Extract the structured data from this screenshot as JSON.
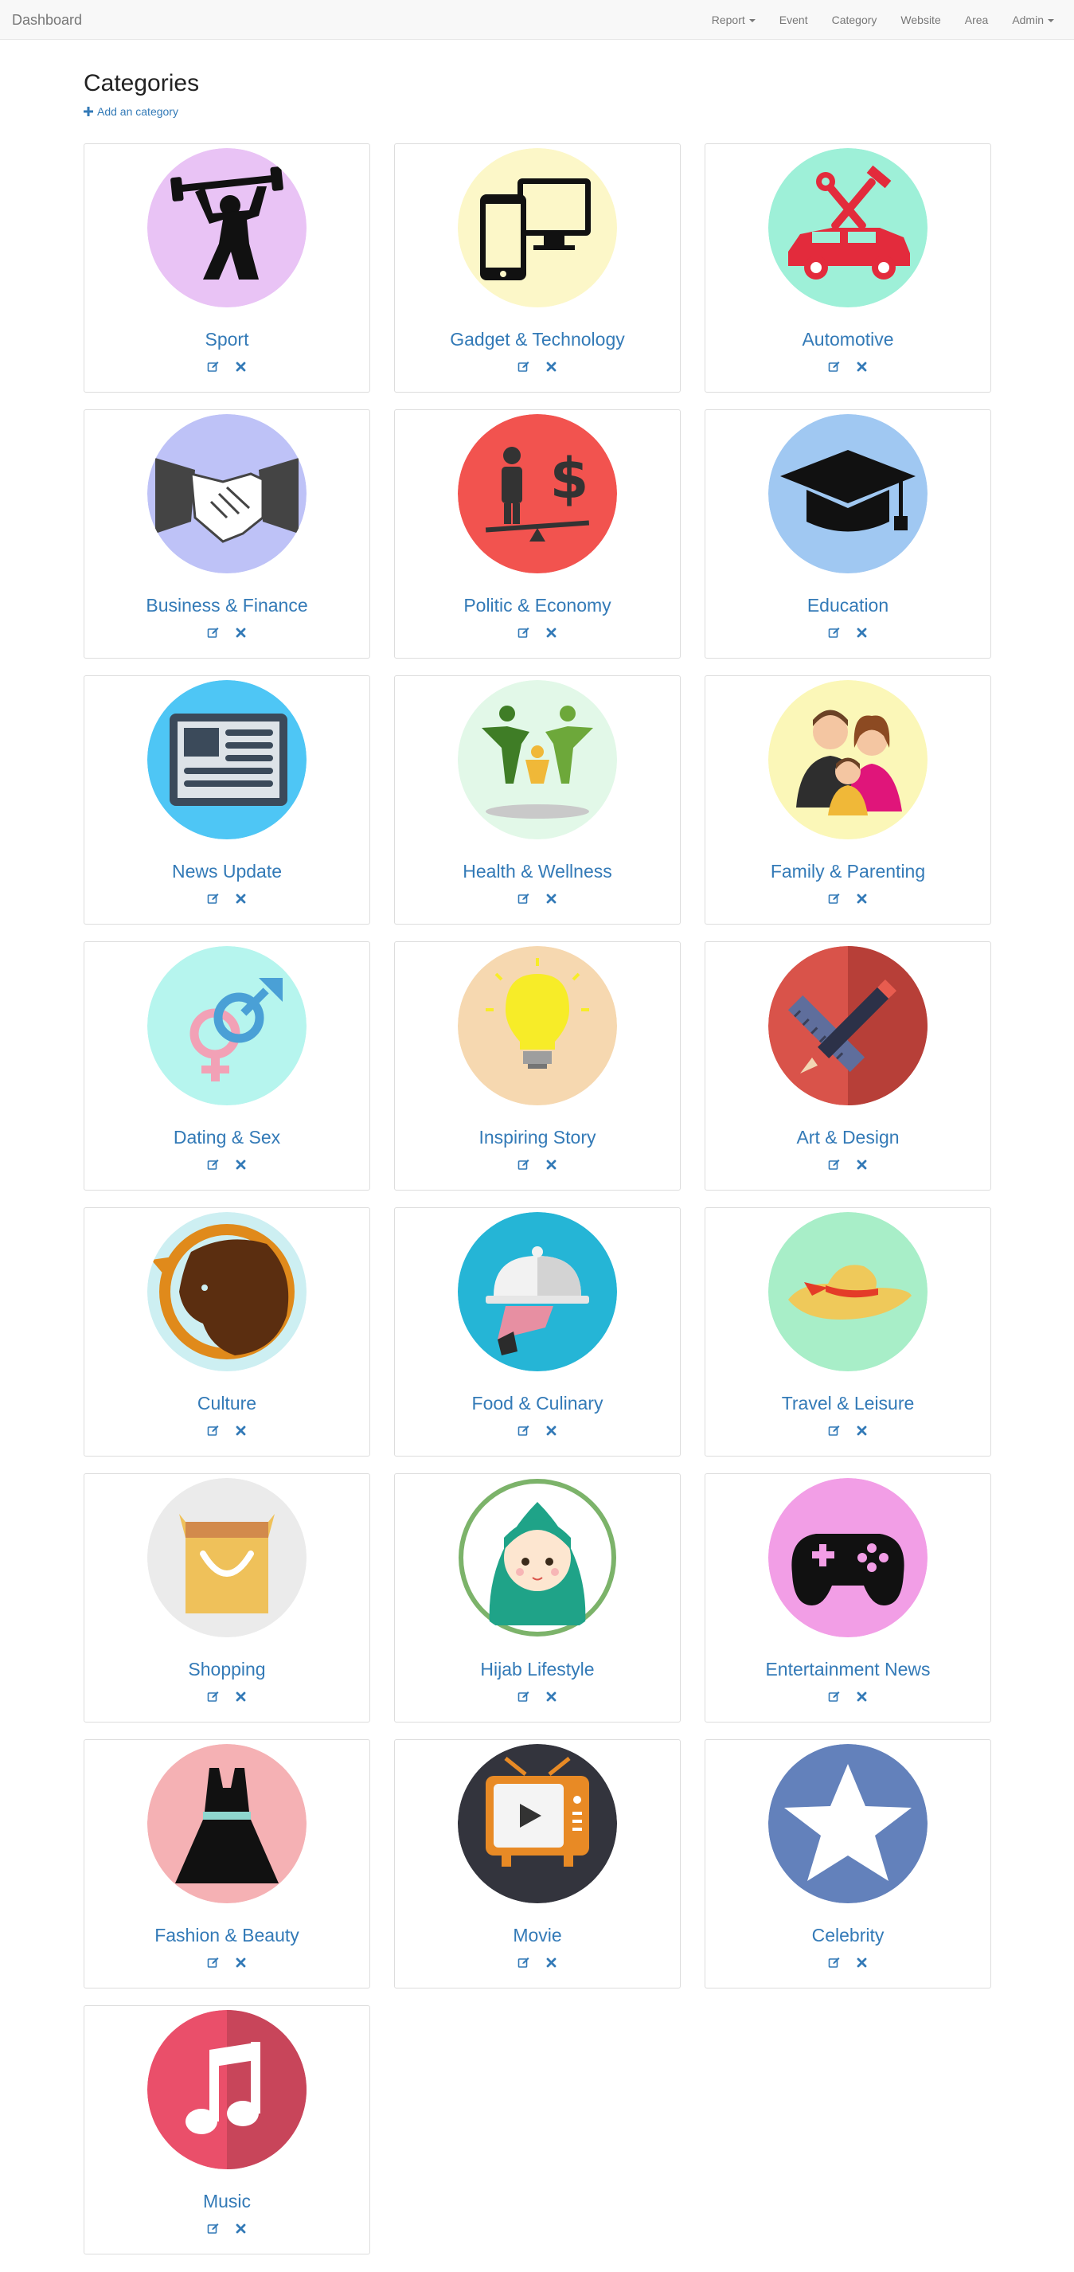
{
  "navbar": {
    "brand": "Dashboard",
    "items": [
      "Report",
      "Event",
      "Category",
      "Website",
      "Area",
      "Admin"
    ]
  },
  "page": {
    "title": "Categories",
    "add_label": "Add an category"
  },
  "colors": {
    "link": "#337ab7",
    "navbar_bg": "#f8f8f8"
  },
  "categories": [
    {
      "name": "Sport",
      "bg": "#e9c3f5",
      "icon": "weightlifter-icon"
    },
    {
      "name": "Gadget & Technology",
      "bg": "#fcf7c8",
      "icon": "devices-icon"
    },
    {
      "name": "Automotive",
      "bg": "#9ef0d8",
      "icon": "car-tools-icon"
    },
    {
      "name": "Business & Finance",
      "bg": "#bec2f7",
      "icon": "handshake-icon"
    },
    {
      "name": "Politic & Economy",
      "bg": "#f2534f",
      "icon": "balance-icon"
    },
    {
      "name": "Education",
      "bg": "#a0c8f2",
      "icon": "graduation-cap-icon"
    },
    {
      "name": "News Update",
      "bg": "#4ec6f5",
      "icon": "newspaper-icon"
    },
    {
      "name": "Health & Wellness",
      "bg": "#e2f8e8",
      "icon": "family-health-icon"
    },
    {
      "name": "Family & Parenting",
      "bg": "#fbf7b8",
      "icon": "family-icon"
    },
    {
      "name": "Dating & Sex",
      "bg": "#b6f5ee",
      "icon": "gender-symbols-icon"
    },
    {
      "name": "Inspiring Story",
      "bg": "#f6d8b0",
      "icon": "lightbulb-icon"
    },
    {
      "name": "Art & Design",
      "bg": "#d9534a",
      "icon": "pencil-ruler-icon"
    },
    {
      "name": "Culture",
      "bg": "#cdeff2",
      "icon": "culture-icon"
    },
    {
      "name": "Food & Culinary",
      "bg": "#25b5d6",
      "icon": "cloche-icon"
    },
    {
      "name": "Travel & Leisure",
      "bg": "#a8eec8",
      "icon": "sun-hat-icon"
    },
    {
      "name": "Shopping",
      "bg": "#ebebeb",
      "icon": "shopping-bag-icon"
    },
    {
      "name": "Hijab Lifestyle",
      "bg": "#ffffff",
      "icon": "hijab-girl-icon"
    },
    {
      "name": "Entertainment News",
      "bg": "#f29ee6",
      "icon": "gamepad-icon"
    },
    {
      "name": "Fashion & Beauty",
      "bg": "#f5b1b4",
      "icon": "dress-icon"
    },
    {
      "name": "Movie",
      "bg": "#33343d",
      "icon": "tv-icon"
    },
    {
      "name": "Celebrity",
      "bg": "#6381bb",
      "icon": "star-icon"
    },
    {
      "name": "Music",
      "bg": "#ea4f6a",
      "icon": "music-note-icon"
    }
  ]
}
